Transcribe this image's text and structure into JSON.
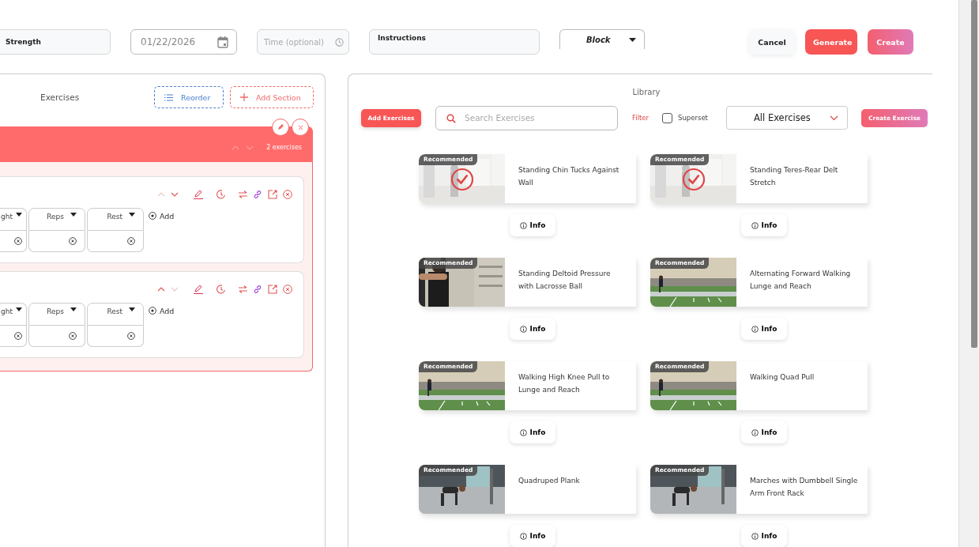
{
  "header": {
    "workout_type": "Strength",
    "date": "01/22/2026",
    "time_placeholder": "Time (optional)",
    "instructions_label": "Instructions",
    "block_select": "Block",
    "buttons": [
      {
        "label": "Cancel",
        "kind": "plain"
      },
      {
        "label": "Generate",
        "kind": "primary"
      },
      {
        "label": "Create",
        "kind": "gradient"
      }
    ]
  },
  "exercises_panel": {
    "title": "Exercises",
    "reorder": "Reorder",
    "add_section": "Add Section",
    "section": {
      "count": "2 exercises",
      "items": [
        {
          "can_move_up": false,
          "can_move_down": true,
          "columns": [
            "ght",
            "Reps",
            "Rest"
          ],
          "add": "Add"
        },
        {
          "can_move_up": true,
          "can_move_down": false,
          "columns": [
            "ght",
            "Reps",
            "Rest"
          ],
          "add": "Add"
        }
      ]
    }
  },
  "library": {
    "title": "Library",
    "add_exercises": "Add Exercises",
    "search_placeholder": "Search Exercises",
    "filter": "Filter",
    "superset": {
      "label": "Superset",
      "checked": false
    },
    "category": "All Exercises",
    "create_exercise": "Create Exercise",
    "exercises": [
      {
        "name": "Standing Chin Tucks Against Wall",
        "badge": "Recommended",
        "selected": true,
        "info": "Info"
      },
      {
        "name": "Standing Teres-Rear Delt Stretch",
        "badge": "Recommended",
        "selected": true,
        "info": "Info"
      },
      {
        "name": "Standing Deltoid Pressure with Lacrosse Ball",
        "badge": "Recommended",
        "selected": false,
        "info": "Info"
      },
      {
        "name": "Alternating Forward Walking Lunge and Reach",
        "badge": "Recommended",
        "selected": false,
        "info": "Info"
      },
      {
        "name": "Walking High Knee Pull to Lunge and Reach",
        "badge": "Recommended",
        "selected": false,
        "info": "Info"
      },
      {
        "name": "Walking Quad Pull",
        "badge": "Recommended",
        "selected": false,
        "info": "Info"
      },
      {
        "name": "Quadruped Plank",
        "badge": "Recommended",
        "selected": false,
        "info": "Info"
      },
      {
        "name": "Marches with Dumbbell Single Arm Front Rack",
        "badge": "Recommended",
        "selected": false,
        "info": "Info"
      }
    ]
  }
}
